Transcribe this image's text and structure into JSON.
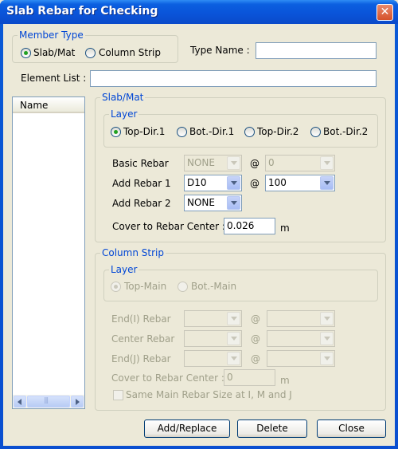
{
  "window": {
    "title": "Slab Rebar for Checking",
    "close_glyph": "✕"
  },
  "member_type": {
    "label": "Member Type",
    "options": [
      "Slab/Mat",
      "Column Strip"
    ],
    "selected": "Slab/Mat"
  },
  "type_name": {
    "label": "Type Name :",
    "value": ""
  },
  "element_list": {
    "label": "Element List :",
    "value": ""
  },
  "name_list": {
    "header": "Name",
    "items": []
  },
  "slab_mat": {
    "label": "Slab/Mat",
    "layer": {
      "label": "Layer",
      "options": [
        "Top-Dir.1",
        "Bot.-Dir.1",
        "Top-Dir.2",
        "Bot.-Dir.2"
      ],
      "selected": "Top-Dir.1"
    },
    "basic_rebar": {
      "label": "Basic Rebar",
      "size": "NONE",
      "at": "@",
      "spacing": "0"
    },
    "add_rebar_1": {
      "label": "Add Rebar 1",
      "size": "D10",
      "at": "@",
      "spacing": "100"
    },
    "add_rebar_2": {
      "label": "Add Rebar 2",
      "size": "NONE"
    },
    "cover": {
      "label": "Cover to Rebar Center :",
      "value": "0.026",
      "unit": "m"
    }
  },
  "column_strip": {
    "label": "Column Strip",
    "layer": {
      "label": "Layer",
      "options": [
        "Top-Main",
        "Bot.-Main"
      ],
      "selected": "Top-Main"
    },
    "end_i_rebar": {
      "label": "End(I) Rebar",
      "at": "@"
    },
    "center_rebar": {
      "label": "Center Rebar",
      "at": "@"
    },
    "end_j_rebar": {
      "label": "End(J) Rebar",
      "at": "@"
    },
    "cover": {
      "label": "Cover to Rebar Center :",
      "value": "0",
      "unit": "m"
    },
    "same_main": {
      "label": "Same Main Rebar Size at I, M and J",
      "checked": false
    }
  },
  "buttons": {
    "add_replace": "Add/Replace",
    "delete": "Delete",
    "close": "Close"
  }
}
